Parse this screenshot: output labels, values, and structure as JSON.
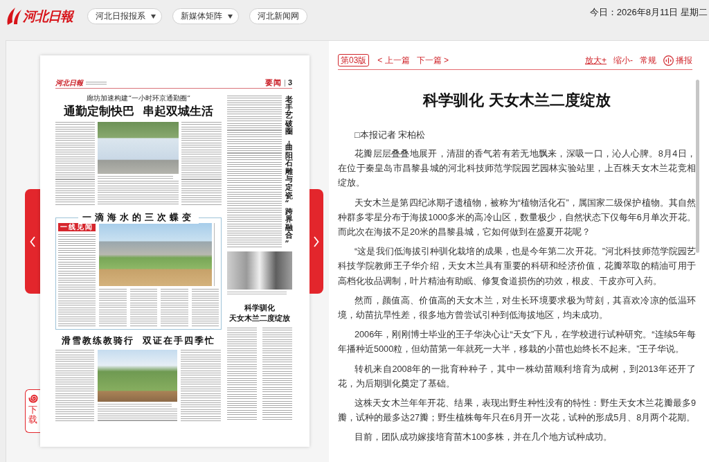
{
  "header": {
    "logo": "河北日報",
    "menus": [
      {
        "label": "河北日报报系",
        "dropdown": true
      },
      {
        "label": "新媒体矩阵",
        "dropdown": true
      },
      {
        "label": "河北新闻网",
        "dropdown": false
      }
    ],
    "date": "今日：2026年8月11日 星期二"
  },
  "page_viewer": {
    "download": "下载",
    "newspaper_page": {
      "masthead": "河北日報",
      "section": "要闻",
      "page_number": "3",
      "top_story": {
        "kicker": "廊坊加速构建“一小时环京通勤圈”",
        "headline": "通勤定制快巴 串起双城生活"
      },
      "side_story": {
        "headline": "老手艺破圈，曲阳石雕与定瓷“跨界融合”"
      },
      "boxed_story": {
        "headline": "一滴海水的三次蝶变",
        "column_label": "一线见闻"
      },
      "feature_story": {
        "headline": "科学驯化",
        "subheadline": "天女木兰二度绽放"
      },
      "bottom_story": {
        "headline": "滑雪教练教骑行 双证在手四季忙"
      }
    }
  },
  "article": {
    "edition": "第03版",
    "prev_link": "< 上一篇",
    "next_link": "下一篇 >",
    "tools": [
      {
        "label": "放大+",
        "selected": true
      },
      {
        "label": "缩小-",
        "selected": false
      },
      {
        "label": "常规",
        "selected": false
      }
    ],
    "broadcast": "播报",
    "title": "科学驯化 天女木兰二度绽放",
    "byline": "□本报记者 宋柏松",
    "paragraphs": [
      "花瓣层层叠叠地展开，清甜的香气若有若无地飘来，深吸一口，沁人心脾。8月4日，在位于秦皇岛市昌黎县城的河北科技师范学院园艺园林实验站里，上百株天女木兰花竞相绽放。",
      "天女木兰是第四纪冰期孑遗植物，被称为“植物活化石”，属国家二级保护植物。其自然种群多零星分布于海拔1000多米的高冷山区，数量极少，自然状态下仅每年6月单次开花。而此次在海拔不足20米的昌黎县城，它如何做到在盛夏开花呢？",
      "“这是我们低海拔引种驯化栽培的成果，也是今年第二次开花。”河北科技师范学院园艺科技学院教师王子华介绍，天女木兰具有重要的科研和经济价值，花瓣萃取的精油可用于高档化妆品调制，叶片精油有助眠、修复食道损伤的功效，根皮、干皮亦可入药。",
      "然而，颜值高、价值高的天女木兰，对生长环境要求极为苛刻，其喜欢冷凉的低温环境，幼苗抗旱性差，很多地方曾尝试引种到低海拔地区，均未成功。",
      "2006年，刚刚博士毕业的王子华决心让“天女”下凡，在学校进行试种研究。“连续5年每年播种近5000粒，但幼苗第一年就死一大半，移栽的小苗也始终长不起来。”王子华说。",
      "转机来自2008年的一批育种种子，其中一株幼苗顺利培育为成树，到2013年还开了花，为后期驯化奠定了基础。",
      "这株天女木兰年年开花、结果，表现出野生种性没有的特性：野生天女木兰花瓣最多9瓣，试种的最多达27瓣；野生植株每年只在6月开一次花，试种的形成5月、8月两个花期。",
      "目前，团队成功嫁接培育苗木100多株，并在几个地方试种成功。"
    ]
  }
}
